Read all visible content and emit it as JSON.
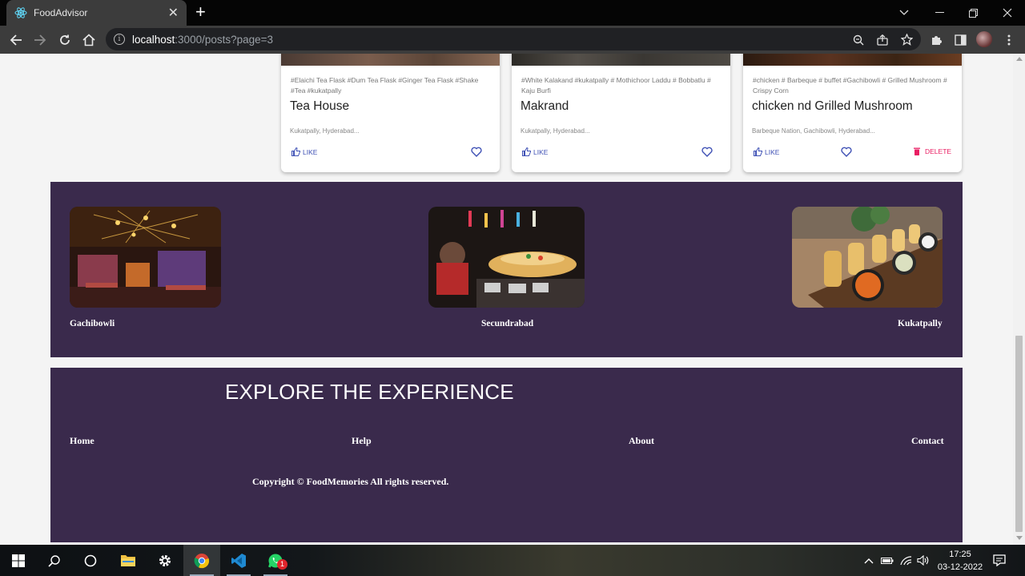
{
  "browser": {
    "tab_title": "FoodAdvisor",
    "new_tab": "+",
    "url_host": "localhost",
    "url_path": ":3000/posts?page=3"
  },
  "cards": [
    {
      "tags": "#Elaichi Tea Flask #Dum Tea Flask #Ginger Tea Flask #Shake #Tea #kukatpally",
      "title": "Tea House",
      "location": "Kukatpally, Hyderabad...",
      "like_label": "LIKE"
    },
    {
      "tags": "#White Kalakand #kukatpally # Mothichoor Laddu # Bobbatlu # Kaju Burfi",
      "title": "Makrand",
      "location": "Kukatpally, Hyderabad...",
      "like_label": "LIKE"
    },
    {
      "tags": "#chicken # Barbeque # buffet #Gachibowli # Grilled Mushroom # Crispy Corn",
      "title": "chicken nd Grilled Mushroom",
      "location": "Barbeque Nation, Gachibowli, Hyderabad...",
      "like_label": "LIKE",
      "delete_label": "DELETE"
    }
  ],
  "places": [
    {
      "name": "Gachibowli"
    },
    {
      "name": "Secundrabad"
    },
    {
      "name": "Kukatpally"
    }
  ],
  "footer": {
    "heading": "EXPLORE THE EXPERIENCE",
    "links": [
      "Home",
      "Help",
      "About",
      "Contact"
    ],
    "copyright": "Copyright © FoodMemories All rights reserved."
  },
  "taskbar": {
    "time": "17:25",
    "date": "03-12-2022",
    "whatsapp_badge": "1"
  },
  "colors": {
    "footer_bg": "#3a2a4c",
    "like": "#3f51b5",
    "delete": "#e91e63"
  }
}
